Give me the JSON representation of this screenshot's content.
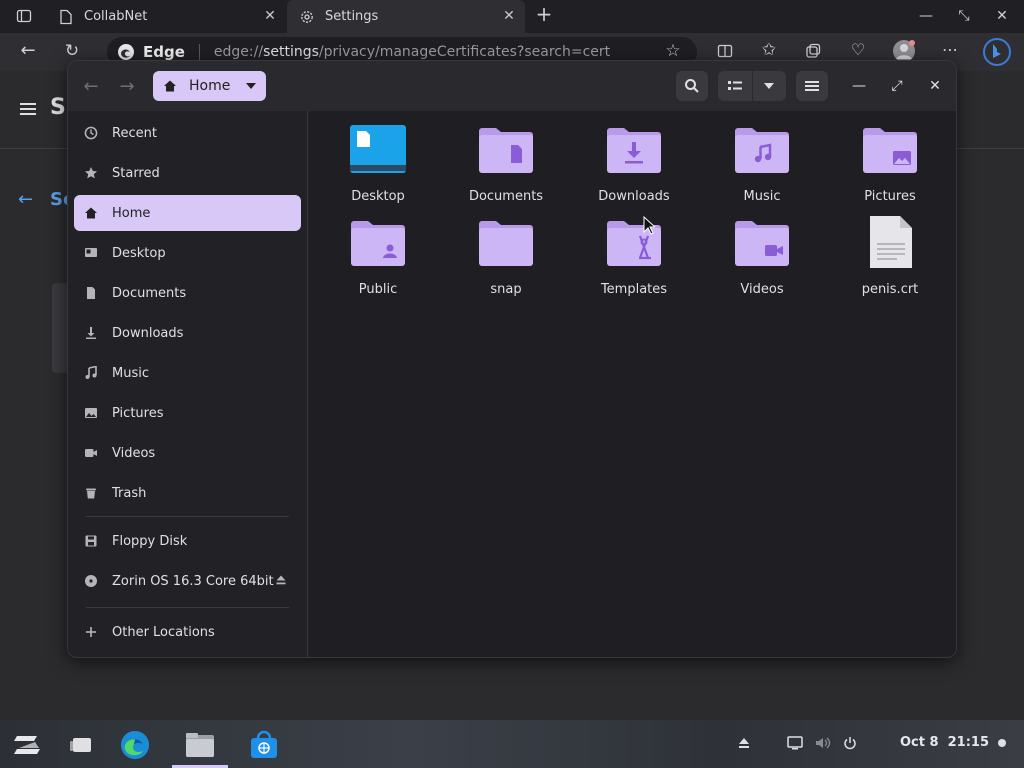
{
  "browser": {
    "tabs": [
      {
        "label": "CollabNet"
      },
      {
        "label": "Settings"
      }
    ],
    "edge_label": "Edge",
    "url_prefix": "edge://",
    "url_bold": "settings",
    "url_rest": "/privacy/manageCertificates?search=cert"
  },
  "settings_page": {
    "title_partial": "S",
    "sub_partial": "Se"
  },
  "file_manager": {
    "path_label": "Home",
    "sidebar": {
      "places": [
        {
          "label": "Recent",
          "icon": "clock-icon"
        },
        {
          "label": "Starred",
          "icon": "star-icon"
        },
        {
          "label": "Home",
          "icon": "home-icon",
          "active": true
        },
        {
          "label": "Desktop",
          "icon": "desktop-icon"
        },
        {
          "label": "Documents",
          "icon": "document-icon"
        },
        {
          "label": "Downloads",
          "icon": "download-icon"
        },
        {
          "label": "Music",
          "icon": "music-icon"
        },
        {
          "label": "Pictures",
          "icon": "picture-icon"
        },
        {
          "label": "Videos",
          "icon": "video-icon"
        },
        {
          "label": "Trash",
          "icon": "trash-icon"
        }
      ],
      "devices": [
        {
          "label": "Floppy Disk",
          "icon": "floppy-icon"
        },
        {
          "label": "Zorin OS 16.3 Core 64bit",
          "icon": "disc-icon"
        }
      ],
      "other": {
        "label": "Other Locations",
        "icon": "plus-icon"
      }
    },
    "items": [
      {
        "label": "Desktop",
        "kind": "desktop"
      },
      {
        "label": "Documents",
        "kind": "documents"
      },
      {
        "label": "Downloads",
        "kind": "downloads"
      },
      {
        "label": "Music",
        "kind": "music"
      },
      {
        "label": "Pictures",
        "kind": "pictures"
      },
      {
        "label": "Public",
        "kind": "public"
      },
      {
        "label": "snap",
        "kind": "plain"
      },
      {
        "label": "Templates",
        "kind": "templates"
      },
      {
        "label": "Videos",
        "kind": "videos"
      },
      {
        "label": "penis.crt",
        "kind": "file"
      }
    ]
  },
  "taskbar": {
    "date": "Oct 8",
    "time": "21:15"
  },
  "colors": {
    "accent": "#d8c8f8",
    "folder": "#cdb6f5",
    "folder_tab": "#b89ae8",
    "folder_glyph": "#8a5cd6"
  }
}
